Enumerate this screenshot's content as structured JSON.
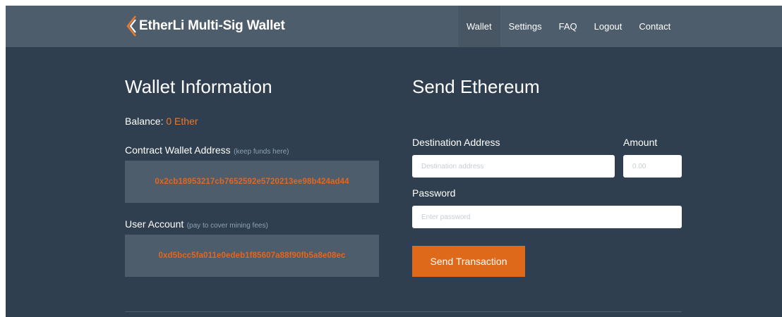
{
  "navbar": {
    "brand": "EtherLi Multi-Sig Wallet",
    "items": [
      {
        "label": "Wallet",
        "active": true
      },
      {
        "label": "Settings"
      },
      {
        "label": "FAQ"
      },
      {
        "label": "Logout"
      },
      {
        "label": "Contact"
      }
    ]
  },
  "wallet_info": {
    "title": "Wallet Information",
    "balance_label": "Balance:",
    "balance_value": "0 Ether",
    "contract_label": "Contract Wallet Address",
    "contract_hint": "(keep funds here)",
    "contract_address": "0x2cb18953217cb7652592e5720213ee98b424ad44",
    "user_label": "User Account",
    "user_hint": "(pay to cover mining fees)",
    "user_address": "0xd5bcc5fa011e0edeb1f85607a88f90fb5a8e08ec"
  },
  "send": {
    "title": "Send Ethereum",
    "destination_label": "Destination Address",
    "destination_placeholder": "Destination address",
    "destination_value": "",
    "amount_label": "Amount",
    "amount_placeholder": "0.00",
    "amount_value": "",
    "password_label": "Password",
    "password_placeholder": "Enter password",
    "password_value": "",
    "button_label": "Send Transaction"
  },
  "colors": {
    "background": "#2f3f4f",
    "navbar": "#4e5d6c",
    "accent": "#df691a",
    "address_text": "#e2661f"
  }
}
